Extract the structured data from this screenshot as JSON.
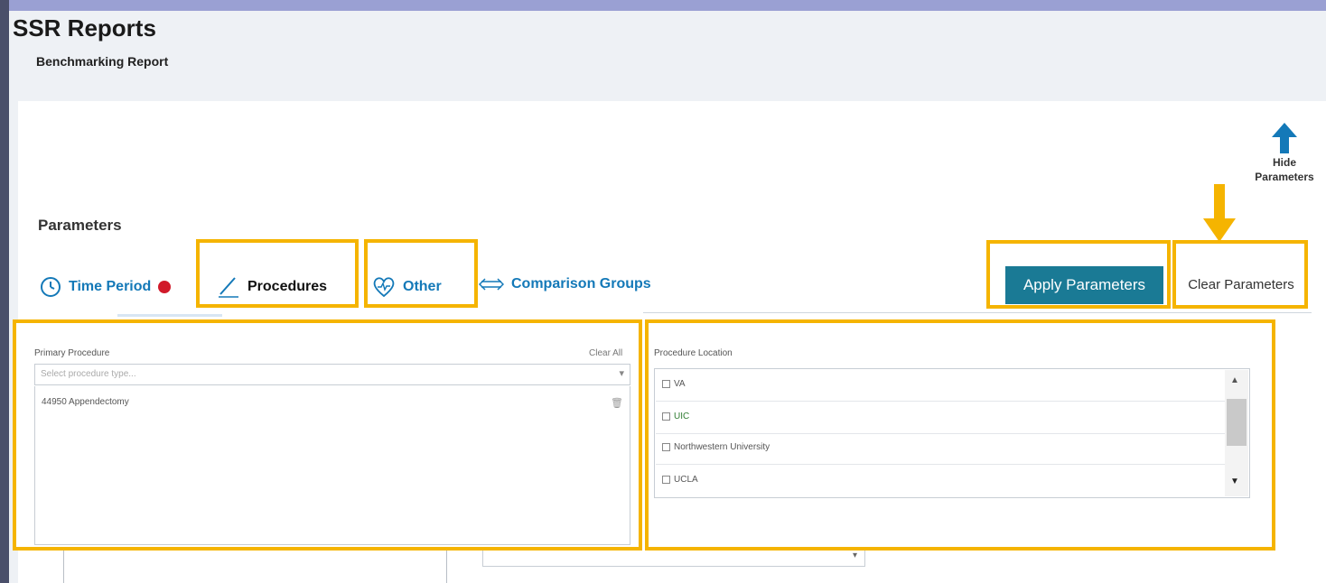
{
  "header": {
    "title": "SSR Reports",
    "subtitle": "Benchmarking Report"
  },
  "hide_parameters": {
    "label_line1": "Hide",
    "label_line2": "Parameters",
    "icon": "arrow-up-icon",
    "icon_color": "#1479b8"
  },
  "parameters": {
    "heading": "Parameters",
    "tabs": [
      {
        "label": "Time Period",
        "icon": "clock-icon",
        "required": true
      },
      {
        "label": "Procedures",
        "icon": "pencil-icon",
        "active": true
      },
      {
        "label": "Other",
        "icon": "heart-pulse-icon"
      },
      {
        "label": "Comparison Groups",
        "icon": "double-arrow-icon"
      }
    ],
    "apply_label": "Apply Parameters",
    "clear_label": "Clear Parameters"
  },
  "primary_procedure": {
    "label": "Primary Procedure",
    "clear_all": "Clear All",
    "placeholder": "Select procedure type...",
    "selected_items": [
      "44950 Appendectomy"
    ]
  },
  "procedure_location": {
    "label": "Procedure Location",
    "options": [
      {
        "label": "VA",
        "checked": false
      },
      {
        "label": "UIC",
        "checked": false
      },
      {
        "label": "Northwestern University",
        "checked": false
      },
      {
        "label": "UCLA",
        "checked": false
      }
    ]
  },
  "colors": {
    "accent": "#1479b8",
    "apply_button": "#1a7a95",
    "highlight": "#f5b400",
    "required_dot": "#d11a2a"
  }
}
